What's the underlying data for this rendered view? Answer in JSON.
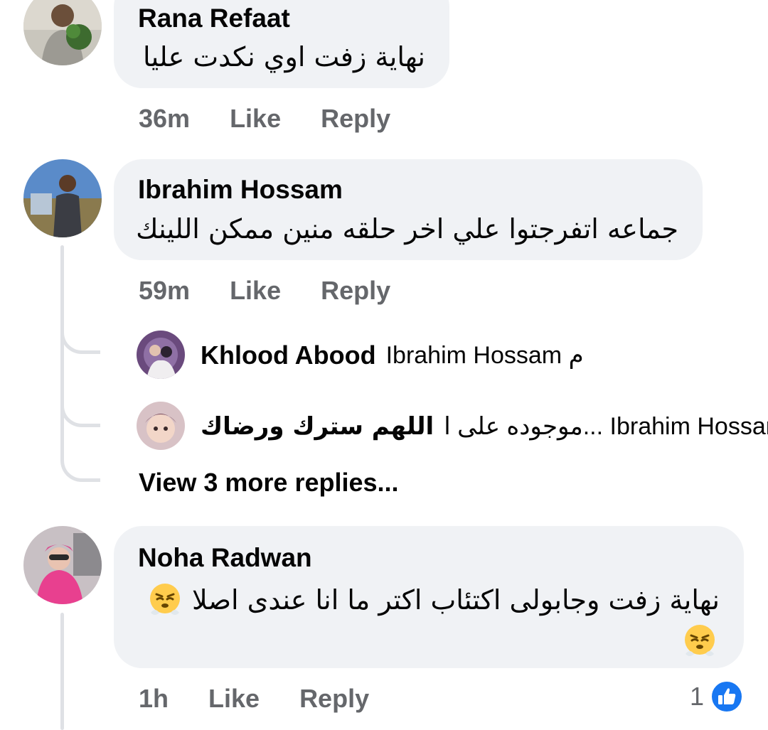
{
  "comments": [
    {
      "author": "Rana Refaat",
      "text": "نهاية زفت اوي نكدت عليا",
      "time": "36m",
      "like_label": "Like",
      "reply_label": "Reply"
    },
    {
      "author": "Ibrahim Hossam",
      "text": "جماعه اتفرجتوا علي اخر حلقه منين ممكن اللينك",
      "time": "59m",
      "like_label": "Like",
      "reply_label": "Reply",
      "replies": [
        {
          "author": "Khlood Abood",
          "text": "Ibrahim Hossam م"
        },
        {
          "author": "اللهم سترك ورضاك",
          "text": "Ibrahim Hossam ...موجوده على ا"
        }
      ],
      "view_more": "View 3 more replies..."
    },
    {
      "author": "Noha Radwan",
      "text": "نهاية زفت وجابولى اكتئاب اكتر ما انا عندى اصلا",
      "time": "1h",
      "like_label": "Like",
      "reply_label": "Reply",
      "reaction_count": "1"
    }
  ],
  "icons": {
    "emoji": "huffing-face-emoji",
    "reaction": "like-thumb-icon"
  },
  "colors": {
    "bubble": "#f0f2f5",
    "meta": "#65676b",
    "like_blue": "#1877f2"
  }
}
